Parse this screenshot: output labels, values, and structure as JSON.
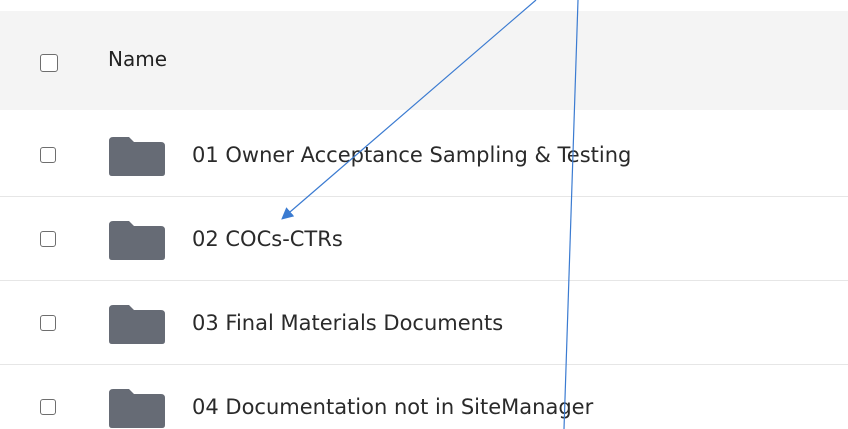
{
  "header": {
    "select_all_checked": false,
    "name_label": "Name"
  },
  "rows": [
    {
      "label": "01 Owner Acceptance Sampling & Testing",
      "icon": "folder-icon",
      "checked": false
    },
    {
      "label": "02 COCs-CTRs",
      "icon": "folder-icon",
      "checked": false
    },
    {
      "label": "03 Final Materials Documents",
      "icon": "folder-icon",
      "checked": false
    },
    {
      "label": "04 Documentation not in SiteManager",
      "icon": "folder-icon",
      "checked": false
    }
  ],
  "colors": {
    "header_bg": "#f4f4f4",
    "folder": "#666b75",
    "annotation_arrow": "#3b7bd1"
  }
}
